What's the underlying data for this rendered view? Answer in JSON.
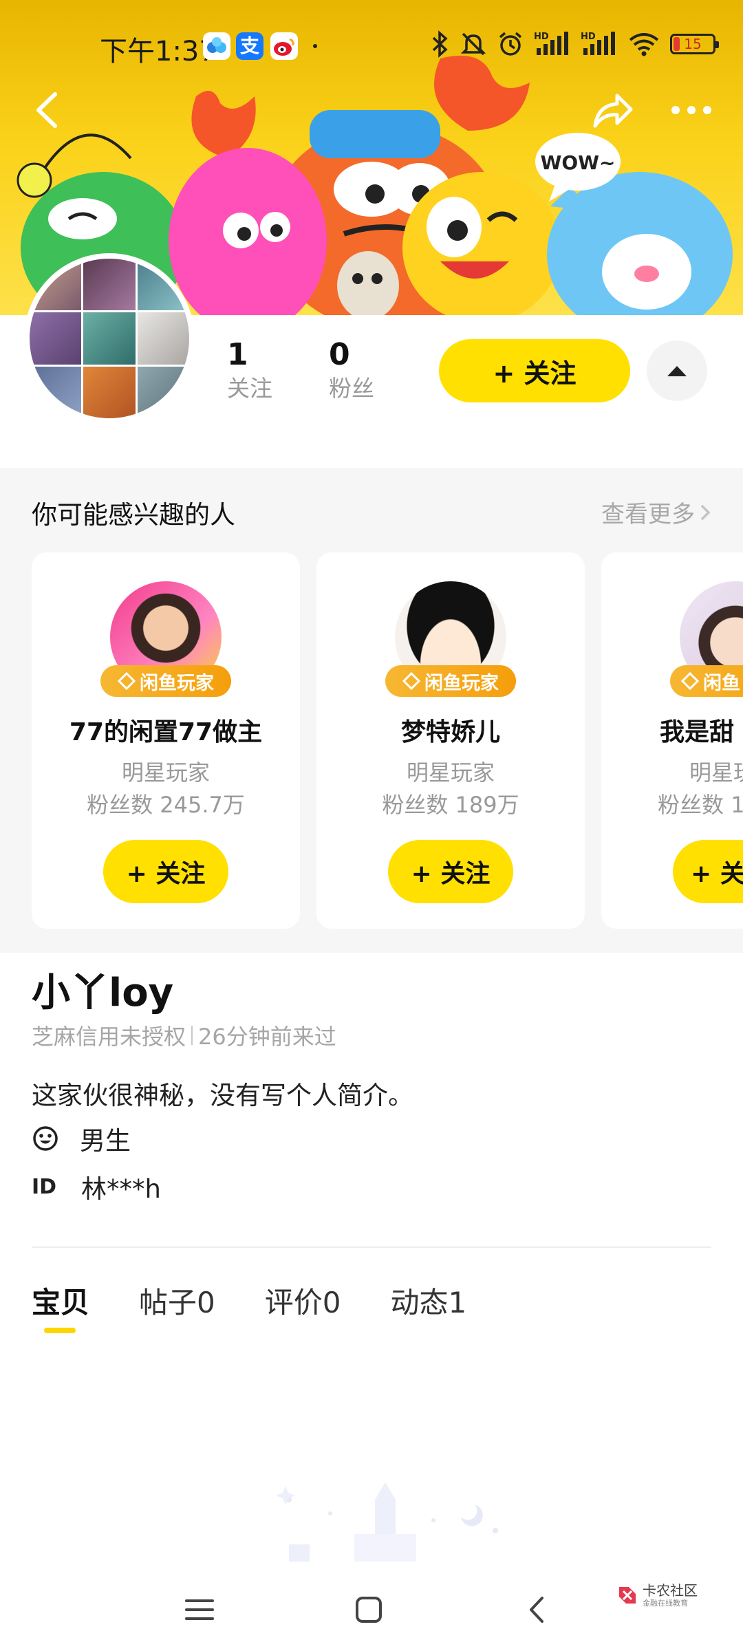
{
  "status_bar": {
    "time": "下午1:37",
    "battery": "15",
    "icons": [
      "baidu-netdisk-icon",
      "alipay-icon",
      "weibo-icon",
      "bluetooth-icon",
      "mute-icon",
      "alarm-icon",
      "signal-hd-1-icon",
      "signal-hd-2-icon",
      "wifi-icon",
      "battery-icon"
    ]
  },
  "top_nav": {
    "back_icon": "back-arrow-icon",
    "share_icon": "share-icon",
    "more_icon": "more-dots-icon"
  },
  "banner": {
    "speech_bubble": "WOW~"
  },
  "profile": {
    "following_count": "1",
    "following_label": "关注",
    "fans_count": "0",
    "fans_label": "粉丝",
    "follow_button": "+ 关注",
    "collapse_icon": "triangle-up-icon"
  },
  "suggestions": {
    "title": "你可能感兴趣的人",
    "see_more": "查看更多",
    "cards": [
      {
        "name": "77的闲置77做主",
        "badge": "闲鱼玩家",
        "tag": "明星玩家",
        "fans": "粉丝数 245.7万",
        "follow": "+ 关注"
      },
      {
        "name": "梦特娇儿",
        "badge": "闲鱼玩家",
        "tag": "明星玩家",
        "fans": "粉丝数 189万",
        "follow": "+ 关注"
      },
      {
        "name": "我是甜",
        "badge": "闲鱼",
        "tag": "明星玩",
        "fans": "粉丝数 1",
        "follow": "+ 关"
      }
    ]
  },
  "user": {
    "name": "小丫loy",
    "credit": "芝麻信用未授权",
    "last_seen": "26分钟前来过",
    "bio": "这家伙很神秘，没有写个人简介。",
    "gender": "男生",
    "id_label": "ID",
    "id_value": "林***h"
  },
  "tabs": [
    {
      "label": "宝贝",
      "active": true
    },
    {
      "label": "帖子0",
      "active": false
    },
    {
      "label": "评价0",
      "active": false
    },
    {
      "label": "动态1",
      "active": false
    }
  ],
  "watermark": {
    "main": "卡农社区",
    "sub": "金融在线教育"
  },
  "colors": {
    "accent_yellow": "#ffe000",
    "badge_orange": "#f59e0b",
    "muted_text": "#999999"
  }
}
